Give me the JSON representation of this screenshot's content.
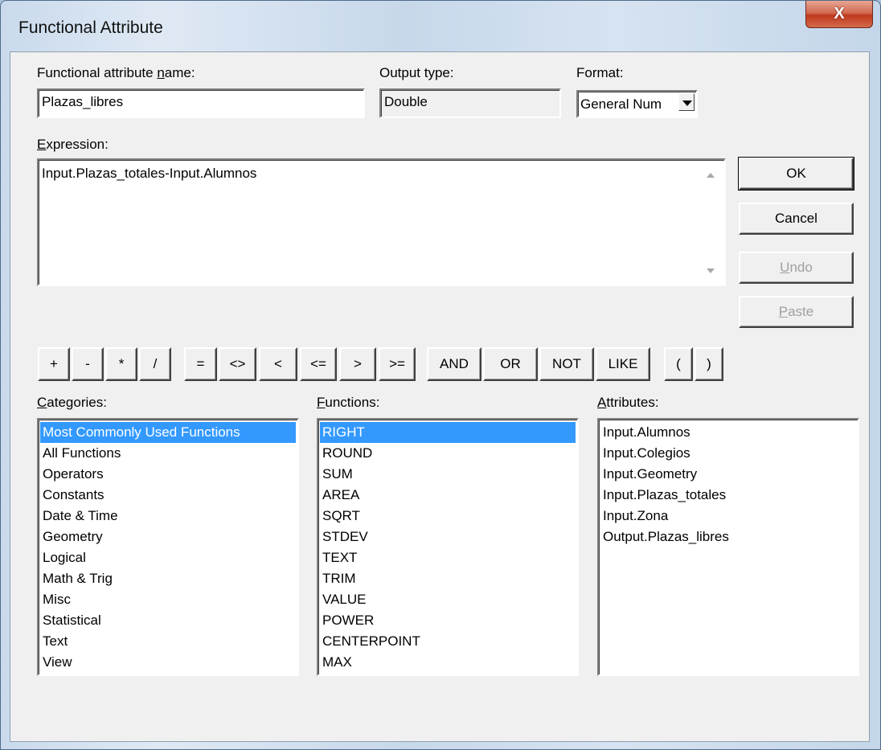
{
  "window": {
    "title": "Functional Attribute",
    "close_glyph": "X"
  },
  "name_field": {
    "label_pre": "Functional attribute ",
    "label_key": "n",
    "label_post": "ame:",
    "value": "Plazas_libres"
  },
  "output_type": {
    "label": "Output type:",
    "value": "Double"
  },
  "format": {
    "label": "Format:",
    "value": "General Num"
  },
  "expression": {
    "label_key": "E",
    "label_post": "xpression:",
    "value": "Input.Plazas_totales-Input.Alumnos"
  },
  "buttons": {
    "ok": "OK",
    "cancel": "Cancel",
    "undo_key": "U",
    "undo_rest": "ndo",
    "paste_key": "P",
    "paste_rest": "aste"
  },
  "operators": [
    "+",
    "-",
    "*",
    "/",
    "=",
    "<>",
    "<",
    "<=",
    ">",
    ">=",
    "AND",
    "OR",
    "NOT",
    "LIKE",
    "(",
    ")"
  ],
  "categories": {
    "label_key": "C",
    "label_post": "ategories:",
    "selected_index": 0,
    "items": [
      "Most Commonly Used Functions",
      "All Functions",
      "Operators",
      "Constants",
      "Date & Time",
      "Geometry",
      "Logical",
      "Math & Trig",
      "Misc",
      "Statistical",
      "Text",
      "View"
    ]
  },
  "functions": {
    "label_key": "F",
    "label_post": "unctions:",
    "selected_index": 0,
    "items": [
      "RIGHT",
      "ROUND",
      "SUM",
      "AREA",
      "SQRT",
      "STDEV",
      "TEXT",
      "TRIM",
      "VALUE",
      "POWER",
      "CENTERPOINT",
      "MAX"
    ]
  },
  "attributes": {
    "label_key": "A",
    "label_post": "ttributes:",
    "items": [
      "Input.Alumnos",
      "Input.Colegios",
      "Input.Geometry",
      "Input.Plazas_totales",
      "Input.Zona",
      "Output.Plazas_libres"
    ]
  },
  "colors": {
    "selection": "#3399ff",
    "dialog_bg": "#f0f0f0",
    "close_red": "#c1391e"
  }
}
